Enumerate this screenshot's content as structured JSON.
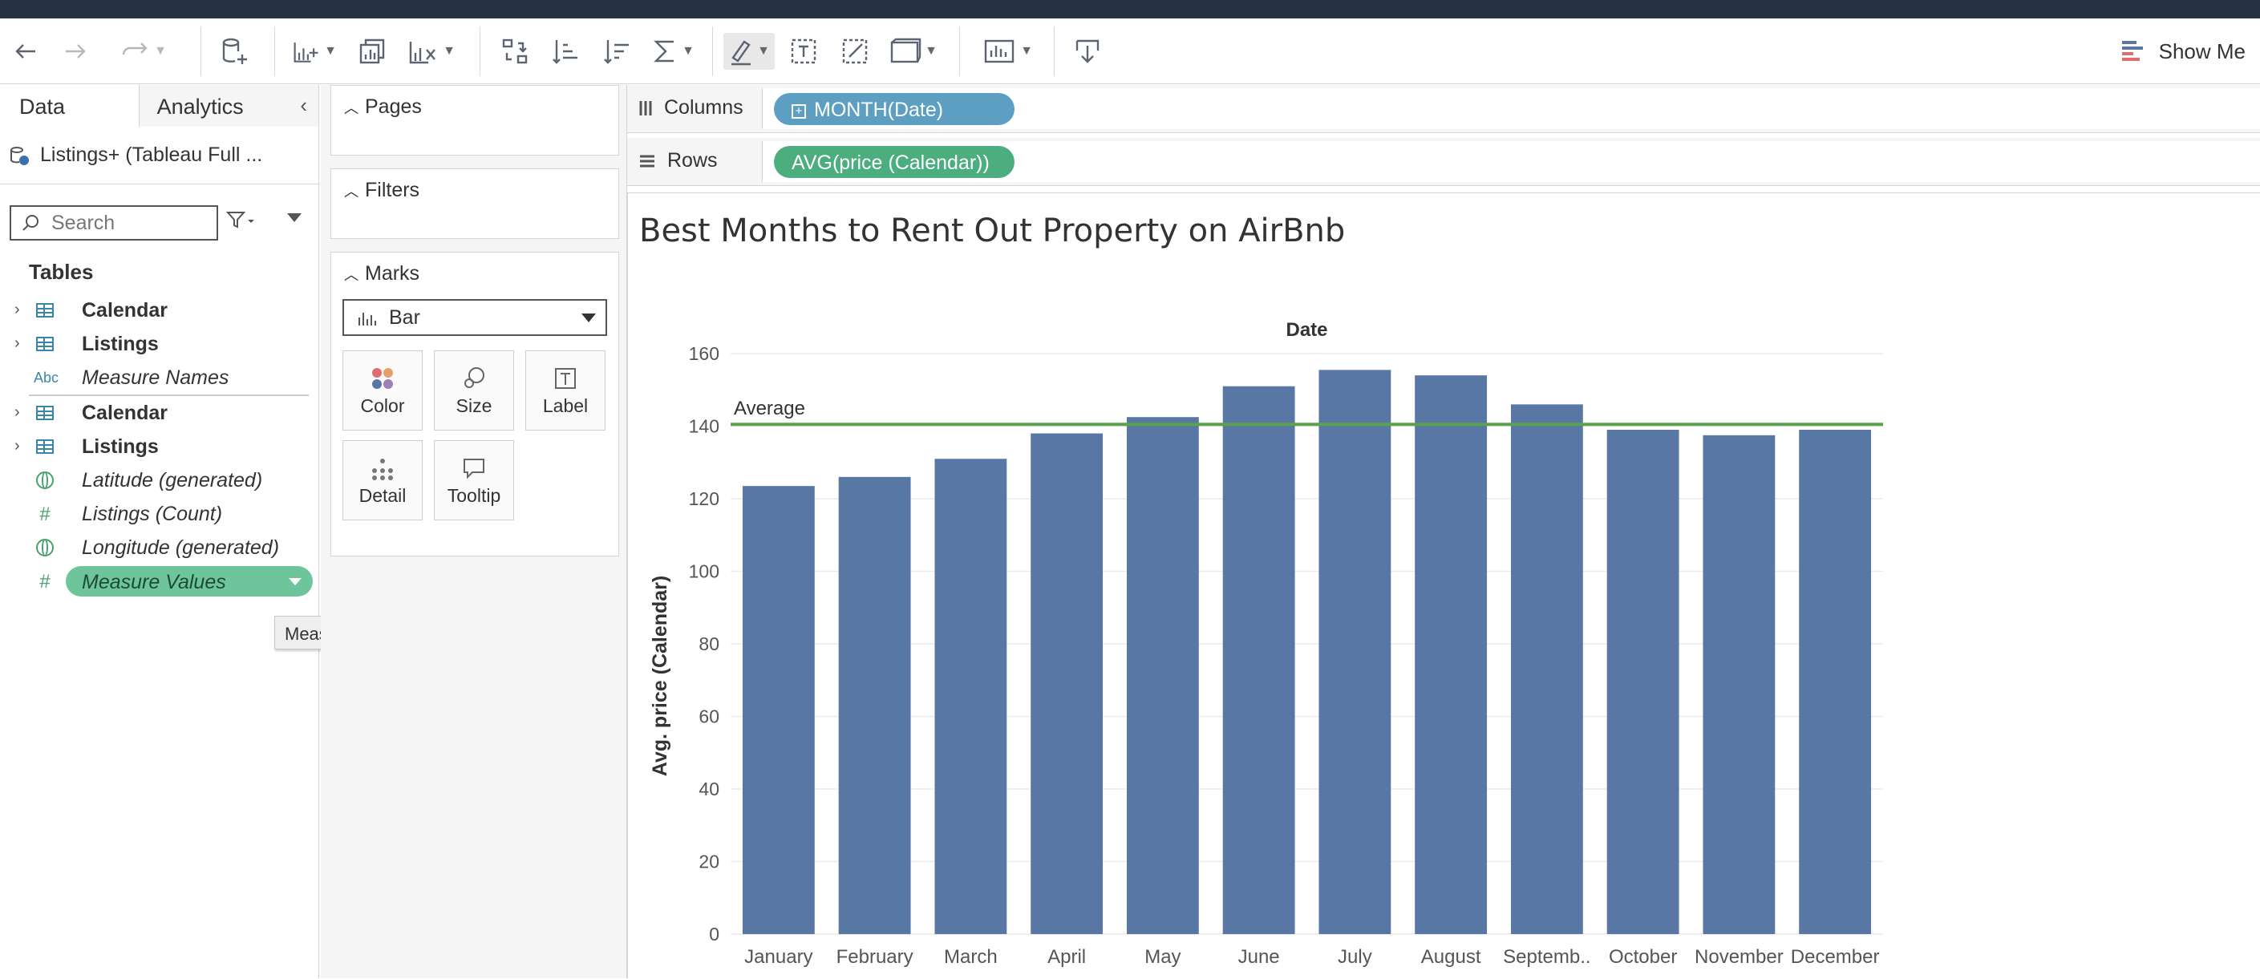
{
  "toolbar": {
    "show_me_label": "Show Me"
  },
  "data_pane": {
    "tabs": [
      "Data",
      "Analytics"
    ],
    "datasource": "Listings+ (Tableau Full ...",
    "search_placeholder": "Search",
    "tables_heading": "Tables",
    "fields": [
      {
        "name": "Calendar",
        "icon": "table-icon",
        "style": "bold",
        "expandable": true
      },
      {
        "name": "Listings",
        "icon": "table-icon",
        "style": "bold",
        "expandable": true
      },
      {
        "name": "Measure Names",
        "icon": "abc-icon",
        "style": "italic",
        "expandable": false
      },
      {
        "name": "Calendar",
        "icon": "table-icon",
        "style": "bold",
        "expandable": true
      },
      {
        "name": "Listings",
        "icon": "table-icon",
        "style": "bold",
        "expandable": true
      },
      {
        "name": "Latitude (generated)",
        "icon": "globe-icon",
        "style": "italic",
        "expandable": false
      },
      {
        "name": "Listings (Count)",
        "icon": "hash-icon",
        "style": "italic",
        "expandable": false
      },
      {
        "name": "Longitude (generated)",
        "icon": "globe-icon",
        "style": "italic",
        "expandable": false
      },
      {
        "name": "Measure Values",
        "icon": "hash-icon",
        "style": "italic",
        "expandable": false,
        "selected": true
      }
    ],
    "tooltip": "Measure Values"
  },
  "shelves": {
    "pages_title": "Pages",
    "filters_title": "Filters",
    "marks_title": "Marks",
    "mark_type": "Bar",
    "mark_buttons": [
      "Color",
      "Size",
      "Label",
      "Detail",
      "Tooltip"
    ],
    "columns_label": "Columns",
    "rows_label": "Rows",
    "columns_pill": "MONTH(Date)",
    "rows_pill": "AVG(price (Calendar))"
  },
  "view": {
    "title": "Best Months to Rent Out Property on AirBnb"
  },
  "colors": {
    "bar": "#5877a5",
    "reference_line": "#5aa34a",
    "pill_blue": "#5d9fc3",
    "pill_green": "#4cae7f"
  },
  "chart_data": {
    "type": "bar",
    "xlabel": "Date",
    "ylabel": "Avg. price (Calendar)",
    "categories": [
      "January",
      "February",
      "March",
      "April",
      "May",
      "June",
      "July",
      "August",
      "Septemb..",
      "October",
      "November",
      "December"
    ],
    "values": [
      123.5,
      126,
      131,
      138,
      142.5,
      151,
      155.5,
      154,
      146,
      139,
      137.5,
      139
    ],
    "ylim": [
      0,
      160
    ],
    "yticks": [
      0,
      20,
      40,
      60,
      80,
      100,
      120,
      140,
      160
    ],
    "reference_line": {
      "label": "Average",
      "value": 140.5
    },
    "grid": true
  }
}
